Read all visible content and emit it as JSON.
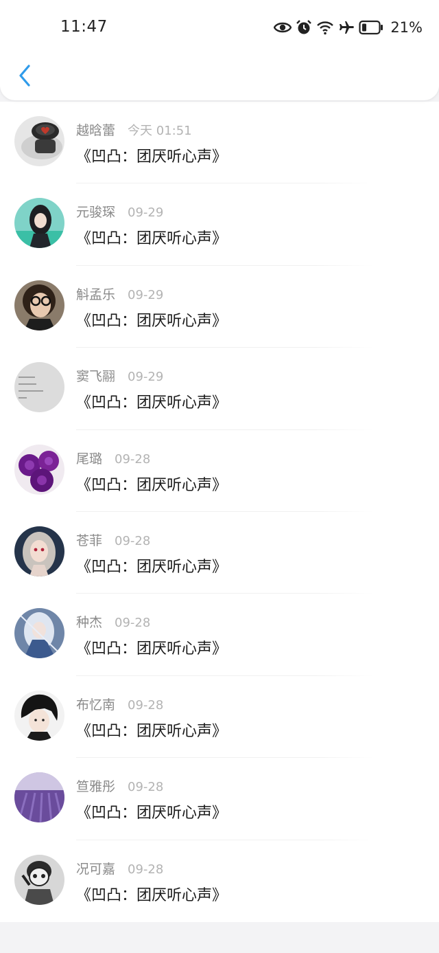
{
  "status_bar": {
    "time": "11:47",
    "battery": "21%",
    "icons": [
      "eye-icon",
      "alarm-icon",
      "wifi-icon",
      "airplane-icon",
      "battery-icon"
    ]
  },
  "header": {
    "back_icon": "chevron-left-icon"
  },
  "accent_color": "#2f9bea",
  "comments": [
    {
      "name": "越晗蕾",
      "date": "今天 01:51",
      "title": "《凹凸：团厌听心声》"
    },
    {
      "name": "元骏琛",
      "date": "09-29",
      "title": "《凹凸：团厌听心声》"
    },
    {
      "name": "斛孟乐",
      "date": "09-29",
      "title": "《凹凸：团厌听心声》"
    },
    {
      "name": "窦飞翮",
      "date": "09-29",
      "title": "《凹凸：团厌听心声》"
    },
    {
      "name": "尾璐",
      "date": "09-28",
      "title": "《凹凸：团厌听心声》"
    },
    {
      "name": "苍菲",
      "date": "09-28",
      "title": "《凹凸：团厌听心声》"
    },
    {
      "name": "种杰",
      "date": "09-28",
      "title": "《凹凸：团厌听心声》"
    },
    {
      "name": "布忆南",
      "date": "09-28",
      "title": "《凹凸：团厌听心声》"
    },
    {
      "name": "笪雅彤",
      "date": "09-28",
      "title": "《凹凸：团厌听心声》"
    },
    {
      "name": "况可嘉",
      "date": "09-28",
      "title": "《凹凸：团厌听心声》"
    }
  ]
}
